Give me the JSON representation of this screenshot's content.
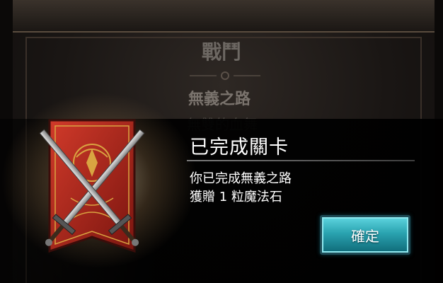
{
  "background_panel": {
    "title": "戰鬥",
    "selected_stage": "無義之路",
    "next_stage": "無雙的血舞"
  },
  "dialog": {
    "title": "已完成關卡",
    "message_line1": "你已完成無義之路",
    "message_line2": "獲贈 1 粒魔法石",
    "confirm_label": "確定"
  },
  "emblem": {
    "icon": "crossed-swords-banner-icon",
    "banner_color": "#b3261e",
    "accent_color": "#d9a441"
  },
  "colors": {
    "button_accent": "#2aa3b0",
    "dialog_text": "#ffffff"
  }
}
